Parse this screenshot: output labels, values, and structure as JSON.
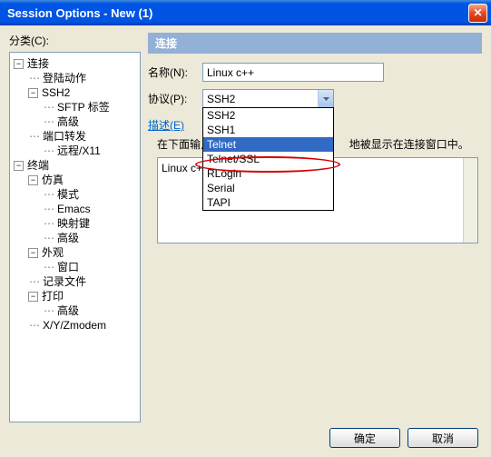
{
  "title": "Session Options - New (1)",
  "sidebar": {
    "label": "分类(C):",
    "tree": [
      {
        "indent": 0,
        "toggle": "−",
        "label": "连接"
      },
      {
        "indent": 1,
        "dots": true,
        "label": "登陆动作"
      },
      {
        "indent": 1,
        "toggle": "−",
        "label": "SSH2"
      },
      {
        "indent": 2,
        "dots": true,
        "label": "SFTP 标签"
      },
      {
        "indent": 2,
        "dots": true,
        "label": "高级"
      },
      {
        "indent": 1,
        "dots": true,
        "label": "端口转发"
      },
      {
        "indent": 2,
        "dots": true,
        "label": "远程/X11"
      },
      {
        "indent": 0,
        "toggle": "−",
        "label": "终端"
      },
      {
        "indent": 1,
        "toggle": "−",
        "label": "仿真"
      },
      {
        "indent": 2,
        "dots": true,
        "label": "模式"
      },
      {
        "indent": 2,
        "dots": true,
        "label": "Emacs"
      },
      {
        "indent": 2,
        "dots": true,
        "label": "映射键"
      },
      {
        "indent": 2,
        "dots": true,
        "label": "高级"
      },
      {
        "indent": 1,
        "toggle": "−",
        "label": "外观"
      },
      {
        "indent": 2,
        "dots": true,
        "label": "窗口"
      },
      {
        "indent": 1,
        "dots": true,
        "label": "记录文件"
      },
      {
        "indent": 1,
        "toggle": "−",
        "label": "打印"
      },
      {
        "indent": 2,
        "dots": true,
        "label": "高级"
      },
      {
        "indent": 1,
        "dots": true,
        "label": "X/Y/Zmodem"
      }
    ]
  },
  "main": {
    "sectionTitle": "连接",
    "nameLabel": "名称(N):",
    "nameValue": "Linux c++",
    "protocolLabel": "协议(P):",
    "protocolSelected": "SSH2",
    "protocolOptions": [
      "SSH2",
      "SSH1",
      "Telnet",
      "Telnet/SSL",
      "RLogin",
      "Serial",
      "TAPI"
    ],
    "highlightedOption": "Telnet",
    "descLabel": "描述(E)",
    "descHint": "在下面输入",
    "descHintSuffix": "地被显示在连接窗口中。",
    "textareaContent": "Linux c++"
  },
  "footer": {
    "ok": "确定",
    "cancel": "取消"
  }
}
